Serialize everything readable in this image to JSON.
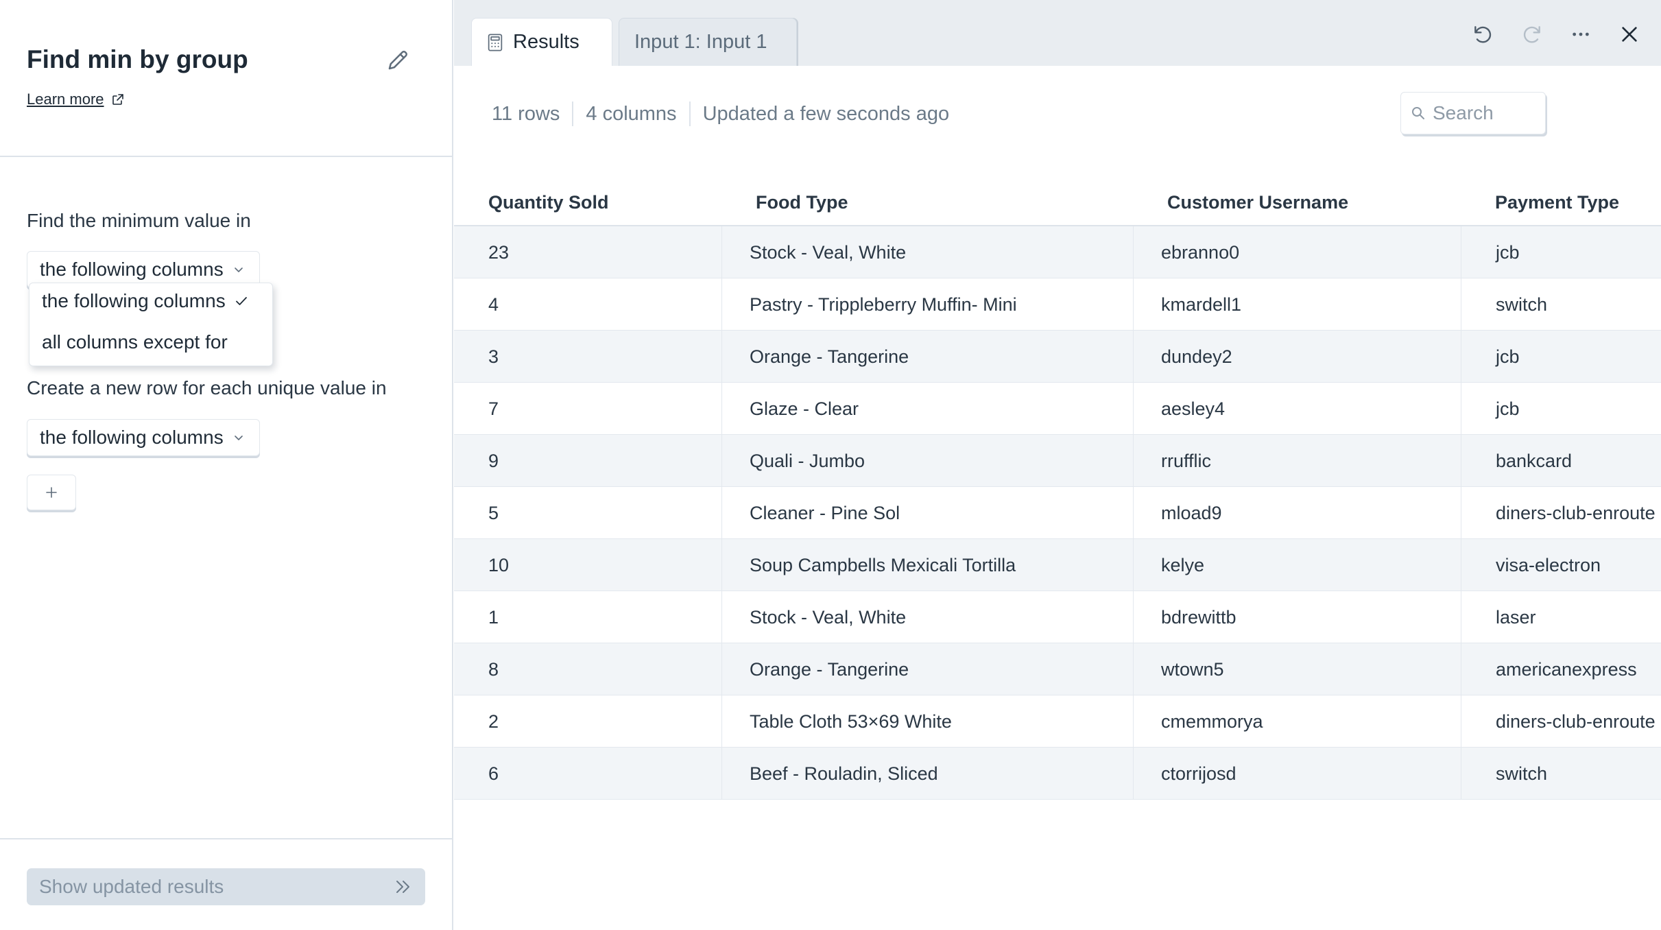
{
  "sidebar": {
    "title": "Find min by group",
    "learn_more": "Learn more",
    "min_label": "Find the minimum value in",
    "min_select": "the following columns",
    "menu_options": [
      "the following columns",
      "all columns except for"
    ],
    "group_label": "Create a new row for each unique value in",
    "group_select": "the following columns",
    "show_results": "Show updated results"
  },
  "tabs": [
    {
      "label": "Results",
      "icon": "calculator-icon",
      "active": true
    },
    {
      "label": "Input 1: Input 1",
      "active": false
    }
  ],
  "toolbar": {
    "icons": [
      "undo-icon",
      "redo-icon",
      "more-icon",
      "close-icon"
    ]
  },
  "summary": {
    "rows": "11 rows",
    "columns": "4 columns",
    "updated": "Updated a few seconds ago"
  },
  "search": {
    "placeholder": "Search",
    "value": ""
  },
  "table": {
    "headers": [
      "Quantity Sold",
      "Food Type",
      "Customer Username",
      "Payment Type"
    ],
    "rows": [
      [
        "23",
        "Stock - Veal, White",
        "ebranno0",
        "jcb"
      ],
      [
        "4",
        "Pastry - Trippleberry Muffin- Mini",
        "kmardell1",
        "switch"
      ],
      [
        "3",
        "Orange - Tangerine",
        "dundey2",
        "jcb"
      ],
      [
        "7",
        "Glaze - Clear",
        "aesley4",
        "jcb"
      ],
      [
        "9",
        "Quali - Jumbo",
        "rrufflic",
        "bankcard"
      ],
      [
        "5",
        "Cleaner - Pine Sol",
        "mload9",
        "diners-club-enroute"
      ],
      [
        "10",
        "Soup Campbells Mexicali Tortilla",
        "kelye",
        "visa-electron"
      ],
      [
        "1",
        "Stock - Veal, White",
        "bdrewittb",
        "laser"
      ],
      [
        "8",
        "Orange - Tangerine",
        "wtown5",
        "americanexpress"
      ],
      [
        "2",
        "Table Cloth 53×69 White",
        "cmemmorya",
        "diners-club-enroute"
      ],
      [
        "6",
        "Beef - Rouladin, Sliced",
        "ctorrijosd",
        "switch"
      ]
    ]
  },
  "colors": {
    "text": "#1e2a36",
    "muted": "#6b7a88",
    "tabbar": "#e9edf1",
    "row_alt": "#f2f5f8",
    "button_disabled": "#d8e0e8"
  }
}
